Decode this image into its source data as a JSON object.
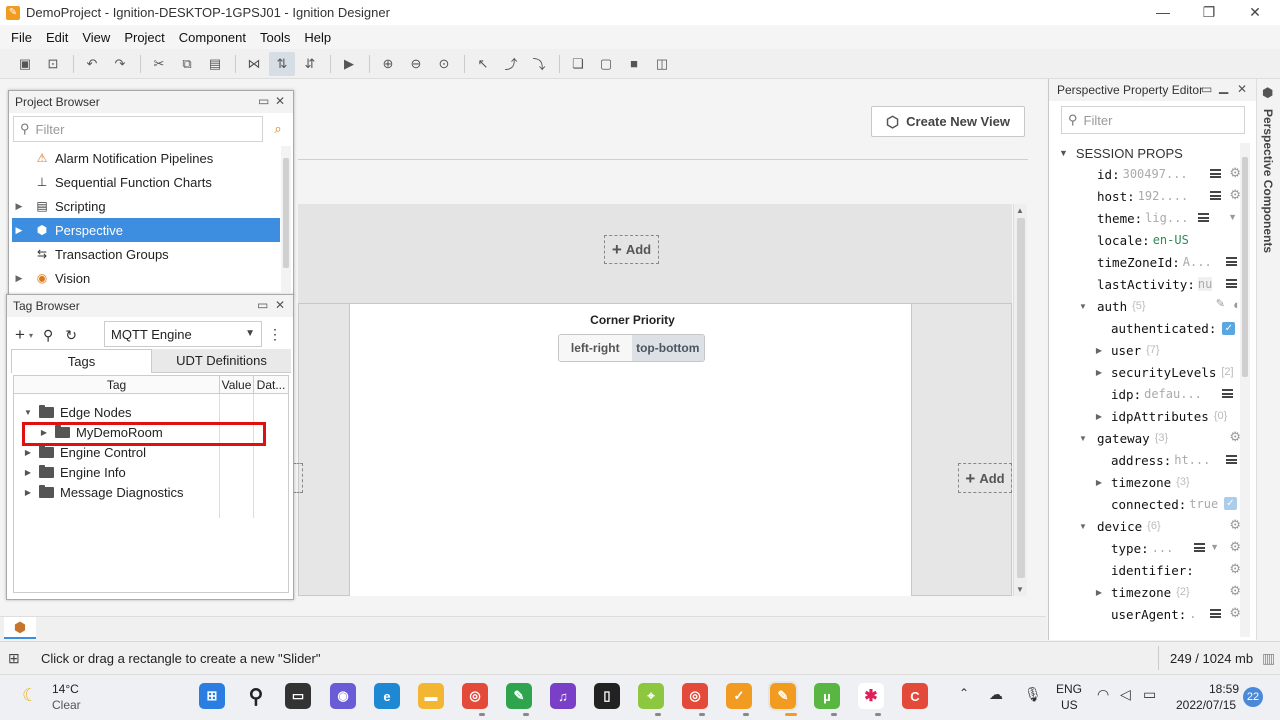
{
  "window": {
    "title": "DemoProject - Ignition-DESKTOP-1GPSJ01 - Ignition Designer",
    "minimize": "—",
    "maximize": "❐",
    "close": "✕"
  },
  "menu": [
    "File",
    "Edit",
    "View",
    "Project",
    "Component",
    "Tools",
    "Help"
  ],
  "canvas": {
    "create_new_view": "Create New View",
    "add_top": "Add",
    "add_right": "Add",
    "corner_priority_label": "Corner Priority",
    "corner_options": [
      "left-right",
      "top-bottom"
    ],
    "corner_selected": "top-bottom"
  },
  "project_browser": {
    "title": "Project Browser",
    "filter_placeholder": "Filter",
    "items": [
      {
        "label": "Alarm Notification Pipelines",
        "icon": "alarm-pipeline-icon"
      },
      {
        "label": "Sequential Function Charts",
        "icon": "sfc-icon"
      },
      {
        "label": "Scripting",
        "icon": "script-icon"
      },
      {
        "label": "Perspective",
        "icon": "perspective-icon"
      },
      {
        "label": "Transaction Groups",
        "icon": "transaction-group-icon"
      },
      {
        "label": "Vision",
        "icon": "vision-icon"
      }
    ],
    "selected": "Perspective"
  },
  "tag_browser": {
    "title": "Tag Browser",
    "provider": "MQTT Engine",
    "tabs": [
      "Tags",
      "UDT Definitions"
    ],
    "active_tab": "Tags",
    "columns": [
      "Tag",
      "Value",
      "Dat..."
    ],
    "rows": [
      {
        "label": "Edge Nodes",
        "expanded": true
      },
      {
        "label": "MyDemoRoom",
        "expanded": false
      },
      {
        "label": "Engine Control",
        "expanded": false
      },
      {
        "label": "Engine Info",
        "expanded": false
      },
      {
        "label": "Message Diagnostics",
        "expanded": false
      }
    ]
  },
  "property_editor": {
    "title": "Perspective Property Editor",
    "filter_placeholder": "Filter",
    "section": "SESSION PROPS",
    "side_tab": "Perspective Components",
    "rows": [
      {
        "key": "id",
        "sep": " : ",
        "value": "300497..."
      },
      {
        "key": "host",
        "sep": " : ",
        "value": "192...."
      },
      {
        "key": "theme",
        "sep": " : ",
        "value": "lig..."
      },
      {
        "key": "locale",
        "sep": " : ",
        "value": "en-US"
      },
      {
        "key": "timeZoneId",
        "sep": " : ",
        "value": "A..."
      },
      {
        "key": "lastActivity",
        "sep": " : ",
        "value": "nu"
      },
      {
        "key": "auth",
        "count": "{5}"
      },
      {
        "key": "authenticated",
        "sep": " : "
      },
      {
        "key": "user",
        "count": "{7}"
      },
      {
        "key": "securityLevels",
        "count": "[2]"
      },
      {
        "key": "idp",
        "sep": " : ",
        "value": "defau..."
      },
      {
        "key": "idpAttributes",
        "count": "{0}"
      },
      {
        "key": "gateway",
        "count": "{3}"
      },
      {
        "key": "address",
        "sep": " : ",
        "value": "ht..."
      },
      {
        "key": "timezone",
        "count": "{3}"
      },
      {
        "key": "connected",
        "sep": " : ",
        "value": "true"
      },
      {
        "key": "device",
        "count": "{6}"
      },
      {
        "key": "type",
        "sep": " : ",
        "value": "..."
      },
      {
        "key": "identifier",
        "sep": " : "
      },
      {
        "key": "timezone",
        "count": "{2}"
      },
      {
        "key": "userAgent",
        "sep": " : ",
        "value": "."
      }
    ]
  },
  "status": {
    "message": "Click or drag a rectangle to create a new \"Slider\"",
    "memory": "249 / 1024 mb"
  },
  "taskbar": {
    "weather_temp": "14°C",
    "weather_desc": "Clear",
    "lang": "ENG",
    "region": "US",
    "time": "18:59",
    "date": "2022/07/15",
    "notifications": "22"
  },
  "colors": {
    "selection": "#3d8ee0",
    "highlight_box": "#e01010",
    "accent_orange": "#f29b21"
  }
}
